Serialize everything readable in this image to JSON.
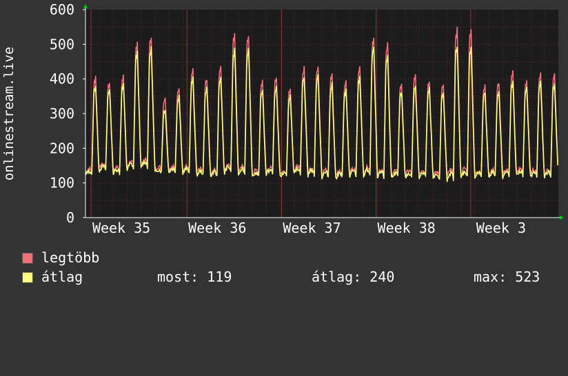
{
  "chart_data": {
    "type": "line",
    "ylabel": "onlinestream.live",
    "ylim": [
      0,
      600
    ],
    "yticks": [
      0,
      100,
      200,
      300,
      400,
      500,
      600
    ],
    "xticks": [
      "Week 35",
      "Week 36",
      "Week 37",
      "Week 38",
      "Week 3"
    ],
    "grid": true,
    "colors": {
      "background": "#333333",
      "plot_bg": "#1c1c1c",
      "grid": "#b03a3a",
      "axis": "#ffffff",
      "arrow": "#00cc00"
    },
    "series": [
      {
        "name": "legtöbb",
        "color": "#f0707a",
        "peaks": [
          415,
          415,
          520,
          355,
          385,
          435,
          545,
          390,
          445,
          450,
          535,
          395,
          405,
          560,
          425,
          430,
          425,
          430
        ]
      },
      {
        "name": "átlag",
        "color": "#ffff80",
        "peaks": [
          390,
          390,
          490,
          320,
          360,
          410,
          495,
          370,
          415,
          420,
          505,
          375,
          380,
          505,
          395,
          400,
          395,
          400
        ]
      }
    ],
    "approx_daily_peaks_legtobb": [
      415,
      400,
      415,
      520,
      535,
      355,
      385,
      435,
      410,
      445,
      545,
      540,
      405,
      415,
      385,
      445,
      450,
      425,
      405,
      445,
      535,
      515,
      395,
      420,
      405,
      395,
      560,
      560,
      390,
      400,
      430,
      405,
      430,
      425
    ],
    "approx_daily_peaks_atlag": [
      390,
      380,
      395,
      490,
      500,
      320,
      360,
      410,
      385,
      415,
      495,
      500,
      380,
      385,
      360,
      415,
      420,
      395,
      380,
      415,
      505,
      480,
      370,
      390,
      380,
      370,
      510,
      505,
      370,
      375,
      400,
      380,
      400,
      395
    ],
    "approx_daily_troughs": [
      115,
      130,
      120,
      130,
      135,
      125,
      125,
      120,
      115,
      110,
      120,
      115,
      110,
      118,
      110,
      120,
      115,
      110,
      108,
      112,
      110,
      105,
      110,
      108,
      112,
      105,
      100,
      105,
      110,
      112,
      110,
      115,
      110,
      112
    ]
  },
  "legend": {
    "max_label": "legtöbb",
    "avg_label": "átlag",
    "stats": {
      "now": "most: 119",
      "avg": "átlag: 240",
      "max": "max: 523"
    }
  }
}
